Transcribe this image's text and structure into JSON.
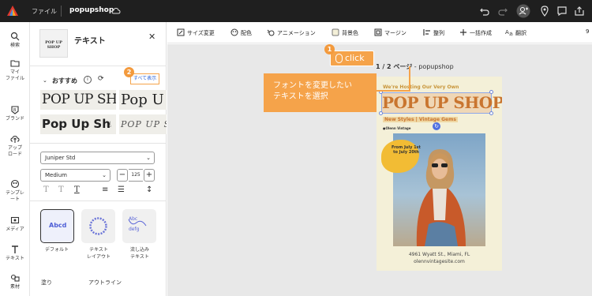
{
  "topbar": {
    "file_menu": "ファイル",
    "doc_name": "popupshop"
  },
  "rail": [
    {
      "label": "検索",
      "icon": "search-icon"
    },
    {
      "label": "マイ\nファイル",
      "icon": "folder-icon"
    },
    {
      "label": "ブランド",
      "icon": "brand-icon"
    },
    {
      "label": "アップ\nロード",
      "icon": "upload-icon"
    },
    {
      "label": "テンプレ\nート",
      "icon": "template-icon"
    },
    {
      "label": "メディア",
      "icon": "media-icon"
    },
    {
      "label": "テキスト",
      "icon": "text-icon"
    },
    {
      "label": "素材",
      "icon": "elements-icon"
    }
  ],
  "panel": {
    "thumb_text": "POP UP SHOP",
    "title": "テキスト",
    "recommended": "おすすめ",
    "see_all": "すべて表示",
    "font_samples": [
      "POP UP SHOP",
      "Pop U",
      "Pop Up Sh",
      "POP UP SHOP"
    ],
    "font_select": "Juniper Std",
    "weight_select": "Medium",
    "size_value": "125",
    "style_cards": [
      {
        "sample": "Abcd",
        "label": "デフォルト"
      },
      {
        "sample": "AEDCAEDC",
        "label": "テキスト\nレイアウト"
      },
      {
        "sample": "Abc\ndefg",
        "label": "流し込み\nテキスト"
      }
    ],
    "fill_label": "塗り",
    "outline_label": "アウトライン"
  },
  "toolbar": {
    "items": [
      "サイズ変更",
      "配色",
      "アニメーション",
      "背景色",
      "マージン",
      "整列",
      "一括作成",
      "翻訳"
    ],
    "overflow": "9"
  },
  "canvas": {
    "page_indicator": "1 / 2 ページ",
    "page_name": "popupshop"
  },
  "annotations": {
    "step1": "1",
    "step2": "2",
    "click_label": "click",
    "callout": "フォントを変更したい\nテキストを選択",
    "accent_color": "#f5a34a"
  },
  "poster": {
    "tagline": "We're Hosting Our Very Own",
    "headline": "POP UP SHOP",
    "subtitle": "New Styles | Vintage Gems",
    "brand": "●Olenn Vintage",
    "dates": "From July 1st\nto July 20th",
    "address": "4961 Wyatt St., Miami, FL",
    "website": "olennvintagesite.com",
    "bg_color": "#f4f0d8",
    "headline_color": "#c9752f"
  }
}
